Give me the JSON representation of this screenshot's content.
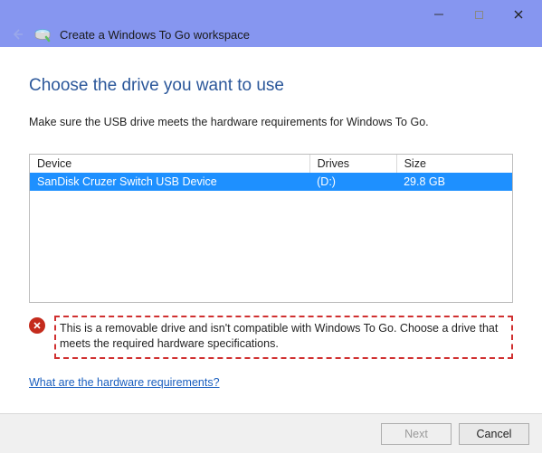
{
  "window": {
    "title": "Create a Windows To Go workspace"
  },
  "page": {
    "heading": "Choose the drive you want to use",
    "instruction": "Make sure the USB drive meets the hardware requirements for Windows To Go."
  },
  "table": {
    "headers": {
      "device": "Device",
      "drives": "Drives",
      "size": "Size"
    },
    "rows": [
      {
        "device": "SanDisk Cruzer Switch USB Device",
        "drives": "(D:)",
        "size": "29.8 GB"
      }
    ]
  },
  "error": {
    "message": "This is a removable drive and isn't compatible with Windows To Go. Choose a drive that meets the required hardware specifications."
  },
  "link": {
    "hardware_requirements": "What are the hardware requirements?"
  },
  "footer": {
    "next": "Next",
    "cancel": "Cancel"
  }
}
